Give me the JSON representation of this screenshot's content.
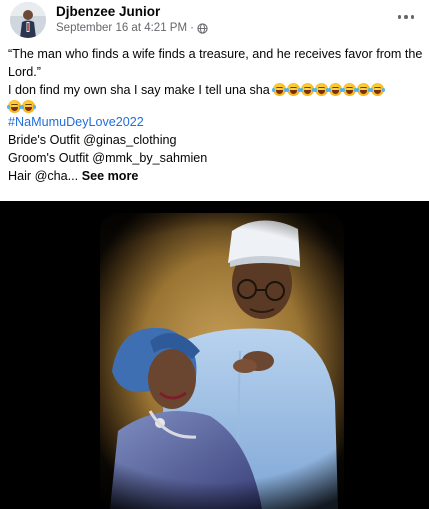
{
  "post": {
    "author": "Djbenzee Junior",
    "date": "September 16 at 4:21 PM",
    "separator": "·",
    "privacy_icon": "globe-icon",
    "more_icon": "more-horizontal-icon"
  },
  "caption": {
    "quote": "“The man who finds a wife finds a treasure, and he receives favor from the Lord.”",
    "line2": " I don find my own sha I say make I tell una sha",
    "emoji_name": "face-with-tears-of-joy",
    "emoji_inline_count": 8,
    "emoji_wrapped_count": 2,
    "hashtag": "#NaMumuDeyLove2022",
    "bride_outfit": "Bride's Outfit @ginas_clothing",
    "groom_outfit": "Groom's Outfit @mmk_by_sahmien",
    "hair": "Hair @cha...",
    "see_more": "See more"
  },
  "colors": {
    "link": "#216fdb",
    "meta": "#65676b",
    "text": "#050505"
  }
}
